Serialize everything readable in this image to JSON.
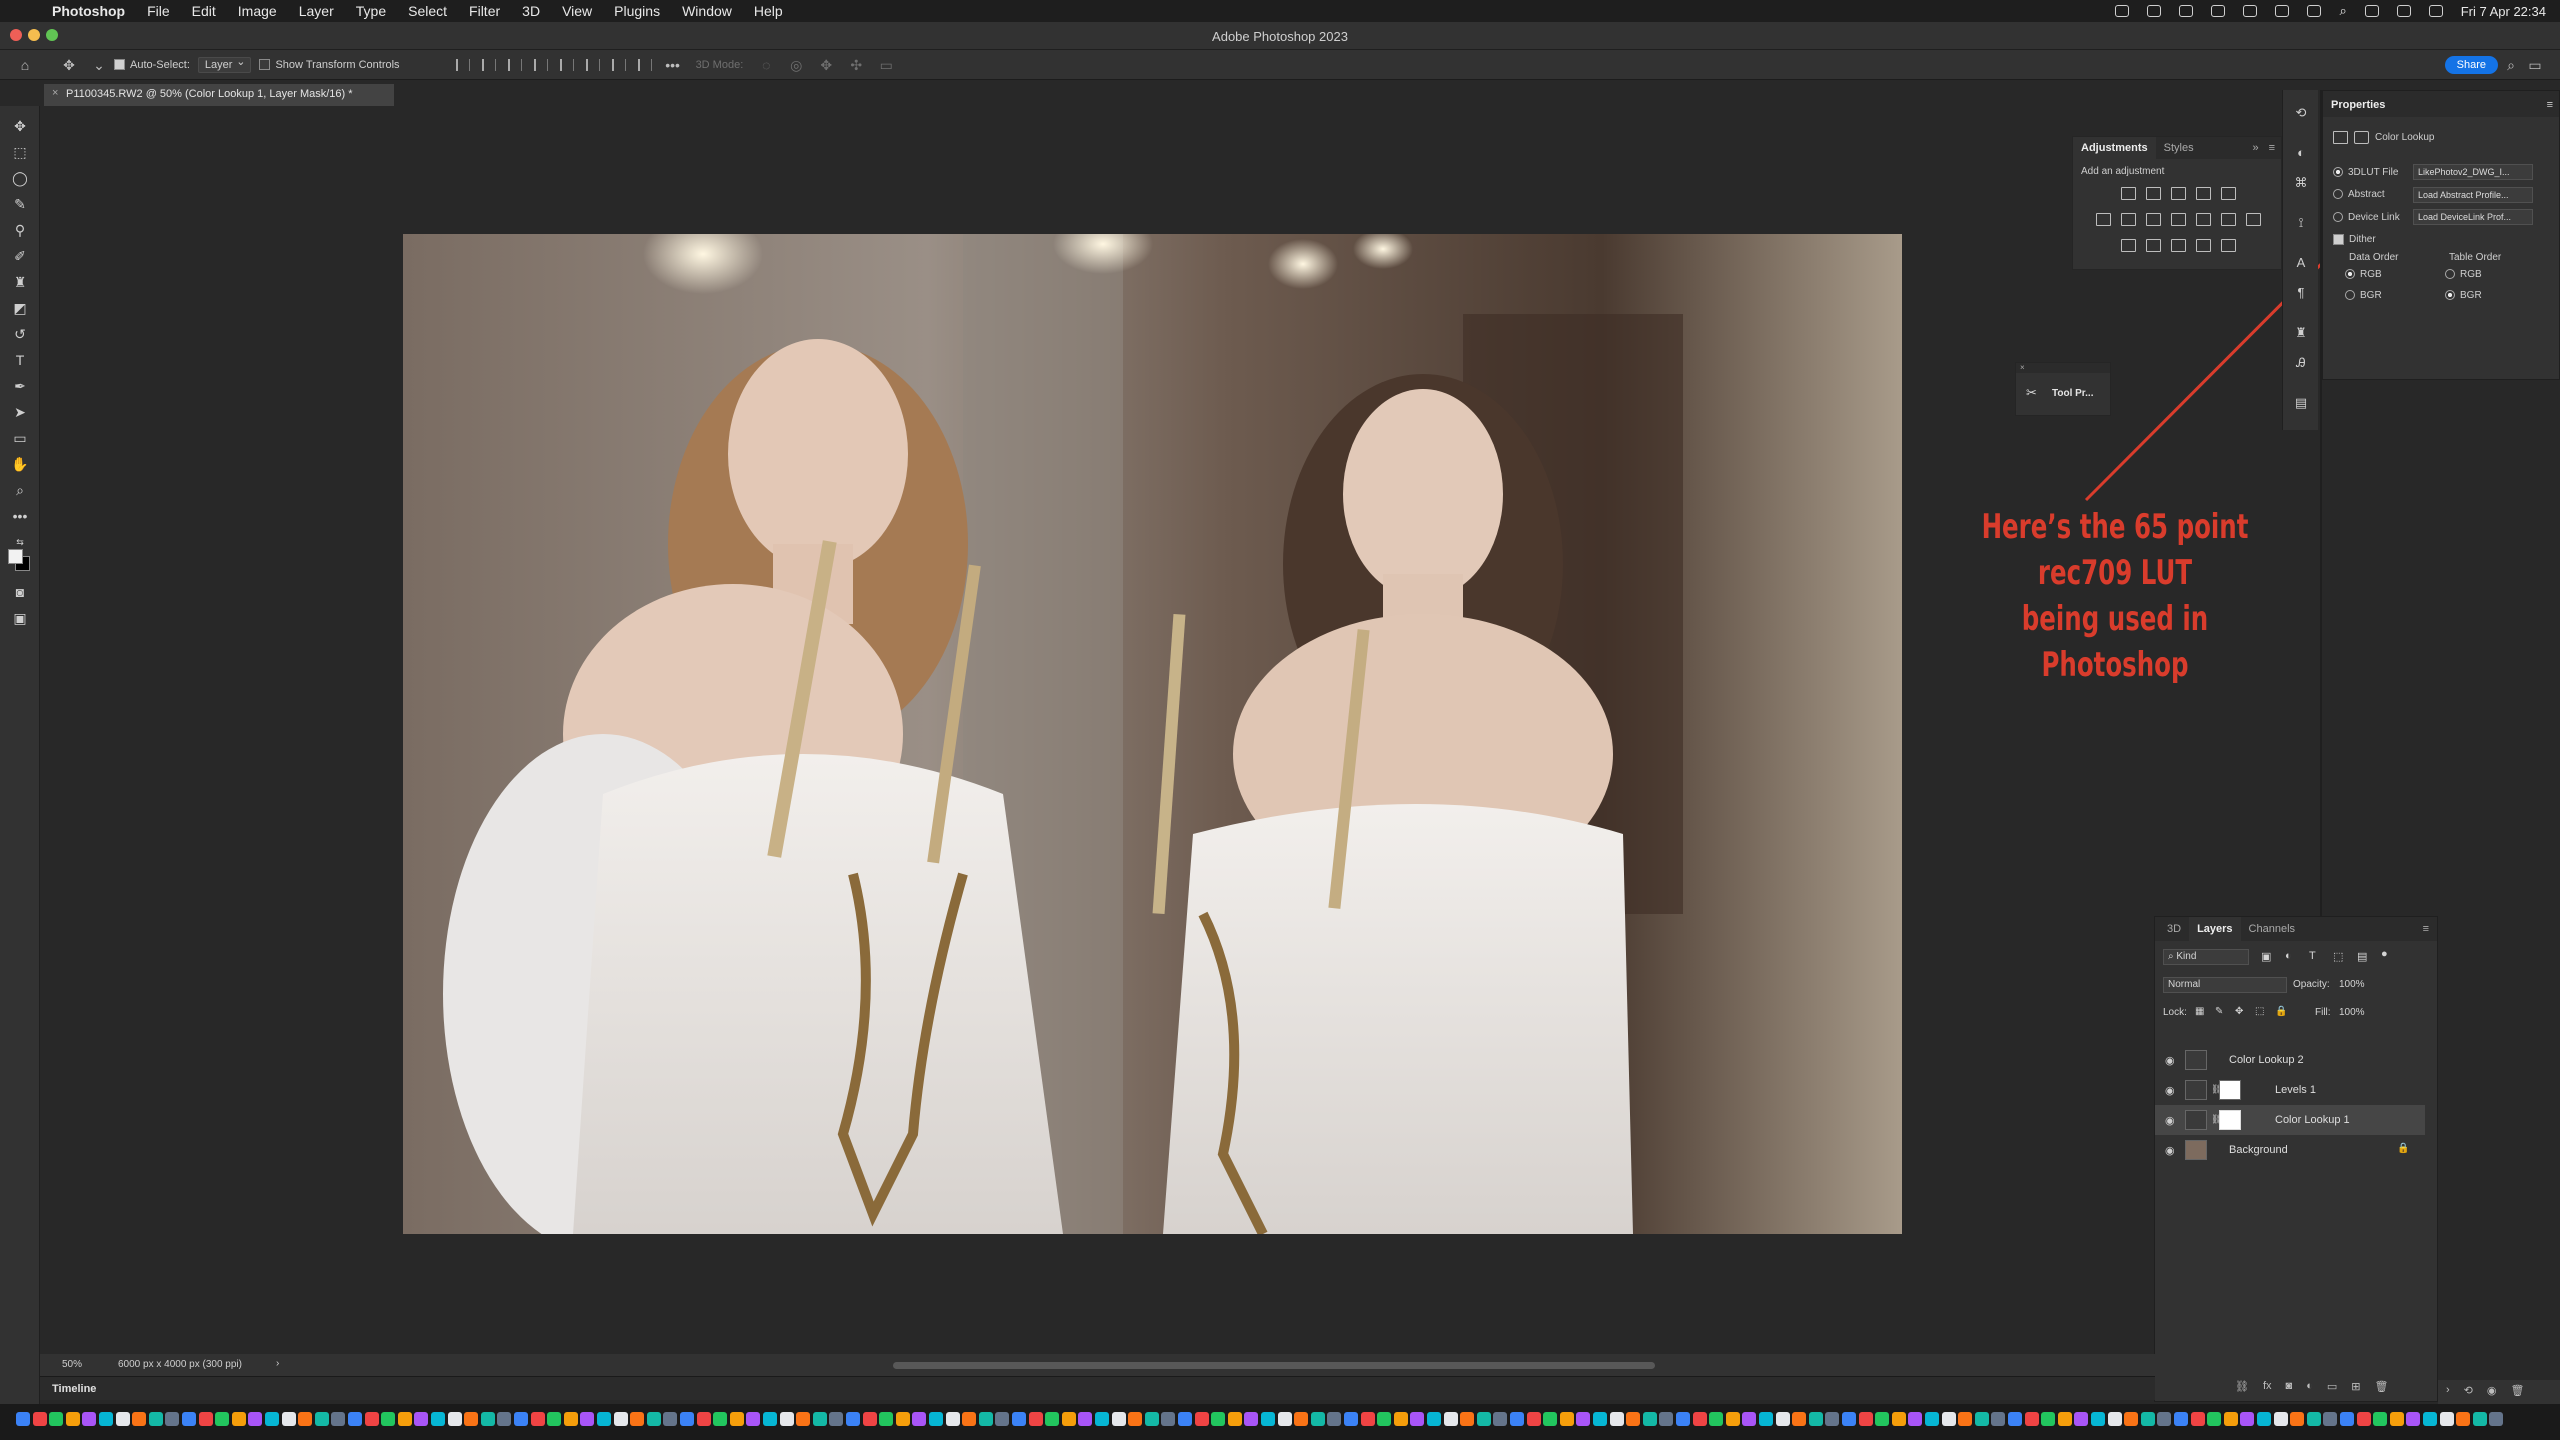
{
  "menubar": {
    "app": "Photoshop",
    "items": [
      "File",
      "Edit",
      "Image",
      "Layer",
      "Type",
      "Select",
      "Filter",
      "3D",
      "View",
      "Plugins",
      "Window",
      "Help"
    ],
    "clock": "Fri 7 Apr  22:34"
  },
  "window": {
    "title": "Adobe Photoshop 2023"
  },
  "optionsbar": {
    "auto_select_label": "Auto-Select:",
    "auto_select_value": "Layer",
    "transform_label": "Show Transform Controls",
    "mode_3d_label": "3D Mode:",
    "share_label": "Share"
  },
  "document": {
    "tab_title": "P1100345.RW2 @ 50% (Color Lookup 1, Layer Mask/16) *",
    "zoom": "50%",
    "dimensions": "6000 px x 4000 px (300 ppi)"
  },
  "annotation": {
    "line1": "Here’s the 65 point rec709 LUT",
    "line2": "being used in Photoshop"
  },
  "adjustments": {
    "tabs": [
      "Adjustments",
      "Styles"
    ],
    "add_label": "Add an adjustment"
  },
  "tool_preset": {
    "label": "Tool Pr..."
  },
  "properties": {
    "title": "Properties",
    "layer_type": "Color Lookup",
    "lut_file_label": "3DLUT File",
    "lut_file_value": "LikePhotov2_DWG_I...",
    "abstract_label": "Abstract",
    "abstract_value": "Load Abstract Profile...",
    "devicelink_label": "Device Link",
    "devicelink_value": "Load DeviceLink Prof...",
    "dither_label": "Dither",
    "data_order_label": "Data Order",
    "table_order_label": "Table Order",
    "rgb": "RGB",
    "bgr": "BGR"
  },
  "layers": {
    "tabs": [
      "3D",
      "Layers",
      "Channels"
    ],
    "kind_label": "Kind",
    "blend_mode": "Normal",
    "opacity_label": "Opacity:",
    "opacity_value": "100%",
    "lock_label": "Lock:",
    "fill_label": "Fill:",
    "fill_value": "100%",
    "items": [
      {
        "name": "Color Lookup 2"
      },
      {
        "name": "Levels 1"
      },
      {
        "name": "Color Lookup 1"
      },
      {
        "name": "Background"
      }
    ]
  },
  "timeline": {
    "label": "Timeline"
  },
  "colors": {
    "annotation": "#d93c2c",
    "share": "#1473e6"
  }
}
